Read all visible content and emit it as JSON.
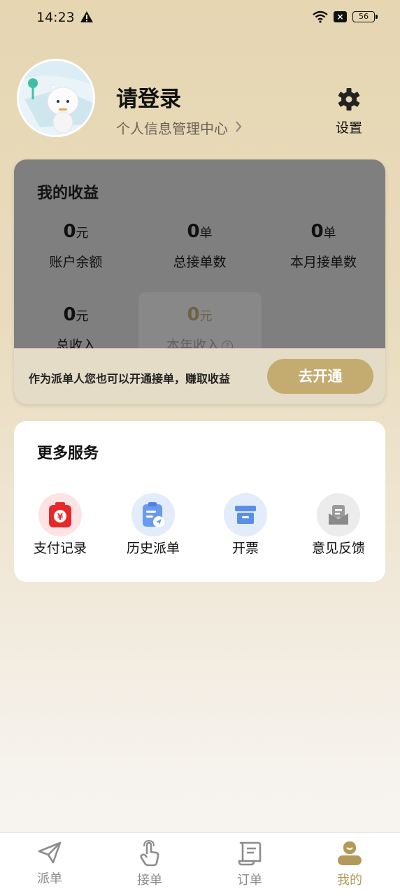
{
  "status": {
    "time": "14:23",
    "battery": "56"
  },
  "profile": {
    "name": "请登录",
    "subtitle": "个人信息管理中心",
    "settings_label": "设置"
  },
  "earnings": {
    "title": "我的收益",
    "stats": [
      {
        "value": "0",
        "unit": "元",
        "label": "账户余额"
      },
      {
        "value": "0",
        "unit": "单",
        "label": "总接单数"
      },
      {
        "value": "0",
        "unit": "单",
        "label": "本月接单数"
      },
      {
        "value": "0",
        "unit": "元",
        "label": "总收入"
      },
      {
        "value": "0",
        "unit": "元",
        "label": "本年收入"
      }
    ],
    "promo_text": "作为派单人您也可以开通接单，赚取收益",
    "promo_button": "去开通"
  },
  "services": {
    "title": "更多服务",
    "items": [
      {
        "label": "支付记录",
        "icon": "payment-record-icon",
        "color": "#e8272b"
      },
      {
        "label": "历史派单",
        "icon": "history-order-icon",
        "color": "#6a9af0"
      },
      {
        "label": "开票",
        "icon": "invoice-icon",
        "color": "#5a8ee8"
      },
      {
        "label": "意见反馈",
        "icon": "feedback-icon",
        "color": "#9a9a9a"
      }
    ]
  },
  "tabs": [
    {
      "label": "派单",
      "icon": "send-icon"
    },
    {
      "label": "接单",
      "icon": "hand-tap-icon"
    },
    {
      "label": "订单",
      "icon": "order-scroll-icon"
    },
    {
      "label": "我的",
      "icon": "profile-icon",
      "active": true
    }
  ],
  "colors": {
    "accent": "#c4ab70",
    "active_tab": "#b39a5a",
    "card_overlay": "#7f7f7f"
  }
}
